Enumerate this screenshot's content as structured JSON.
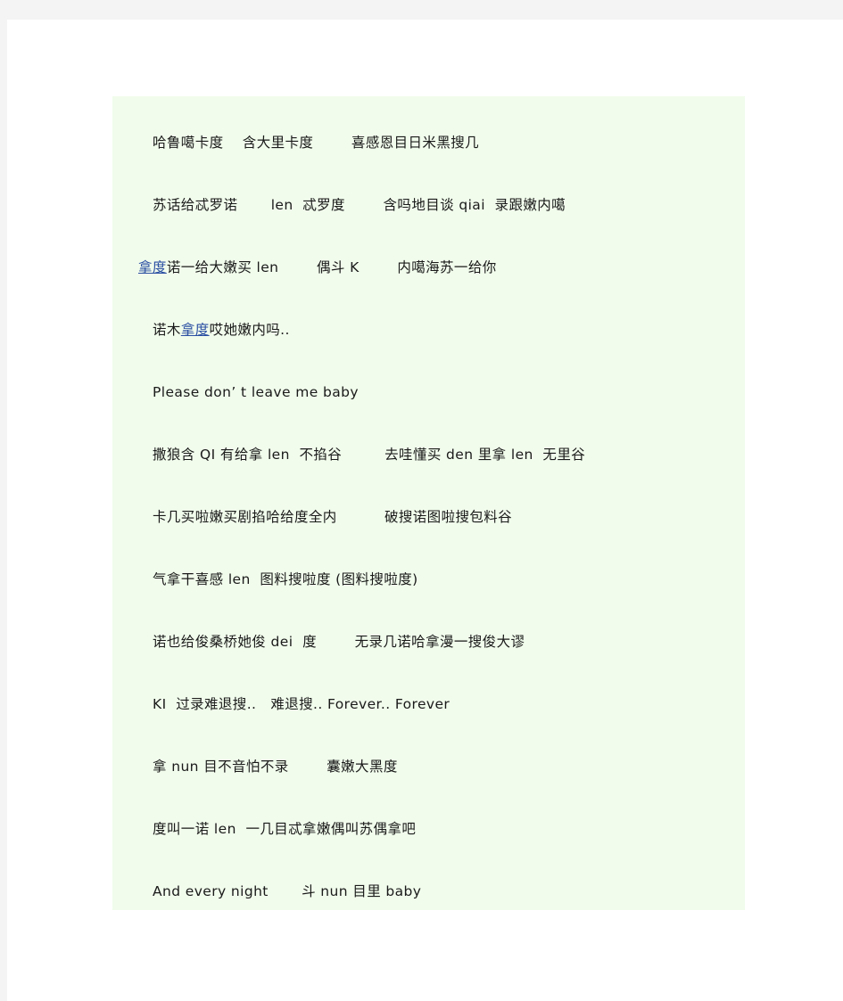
{
  "document": {
    "page_background": "#ffffff",
    "viewer_background": "#f4f4f4",
    "highlight_background": "#f1fcec",
    "link_color": "#2a4ea2",
    "text_color": "#1a1a1a"
  },
  "lyrics": {
    "lines": [
      {
        "indent": 1,
        "segments": [
          {
            "text": "哈鲁噶卡度    含大里卡度        喜感恩目日米黑搜几",
            "style": "plain"
          }
        ]
      },
      {
        "indent": 1,
        "segments": [
          {
            "text": "苏话给忒罗诺       len  忒罗度        含吗地目谈 qiai  录跟嫩内噶",
            "style": "plain"
          }
        ]
      },
      {
        "indent": 2,
        "segments": [
          {
            "text": "拿度",
            "style": "link"
          },
          {
            "text": "诺一给大嫩买 len        偶斗 K        内噶海苏一给你",
            "style": "plain"
          }
        ]
      },
      {
        "indent": 1,
        "segments": [
          {
            "text": "诺木",
            "style": "plain"
          },
          {
            "text": "拿度",
            "style": "link"
          },
          {
            "text": "哎她嫩内吗..",
            "style": "plain"
          }
        ]
      },
      {
        "indent": 1,
        "segments": [
          {
            "text": "Please don’ t leave me baby",
            "style": "latin"
          }
        ]
      },
      {
        "indent": 1,
        "segments": [
          {
            "text": "撒狼含 QI 有给拿 len  不掐谷         去哇懂买 den 里拿 len  无里谷",
            "style": "plain"
          }
        ]
      },
      {
        "indent": 1,
        "segments": [
          {
            "text": "卡几买啦嫩买剧掐哈给度全内          破搜诺图啦搜包料谷",
            "style": "plain"
          }
        ]
      },
      {
        "indent": 1,
        "segments": [
          {
            "text": "气拿干喜感 len  图料搜啦度 (图料搜啦度)",
            "style": "plain"
          }
        ]
      },
      {
        "indent": 1,
        "segments": [
          {
            "text": "诺也给俊桑桥她俊 dei  度        无录几诺哈拿漫一搜俊大谬",
            "style": "plain"
          }
        ]
      },
      {
        "indent": 1,
        "segments": [
          {
            "text": "KI  过录难退搜..   难退搜.. Forever.. Forever",
            "style": "plain"
          }
        ]
      },
      {
        "indent": 1,
        "segments": [
          {
            "text": "拿 nun 目不音怕不录        囊嫩大黑度",
            "style": "plain"
          }
        ]
      },
      {
        "indent": 1,
        "segments": [
          {
            "text": "度叫一诺 len  一几目忒拿嫩偶叫苏偶拿吧",
            "style": "plain"
          }
        ]
      },
      {
        "indent": 1,
        "segments": [
          {
            "text": "And every night       斗 nun 目里 baby",
            "style": "plain"
          }
        ]
      }
    ]
  }
}
